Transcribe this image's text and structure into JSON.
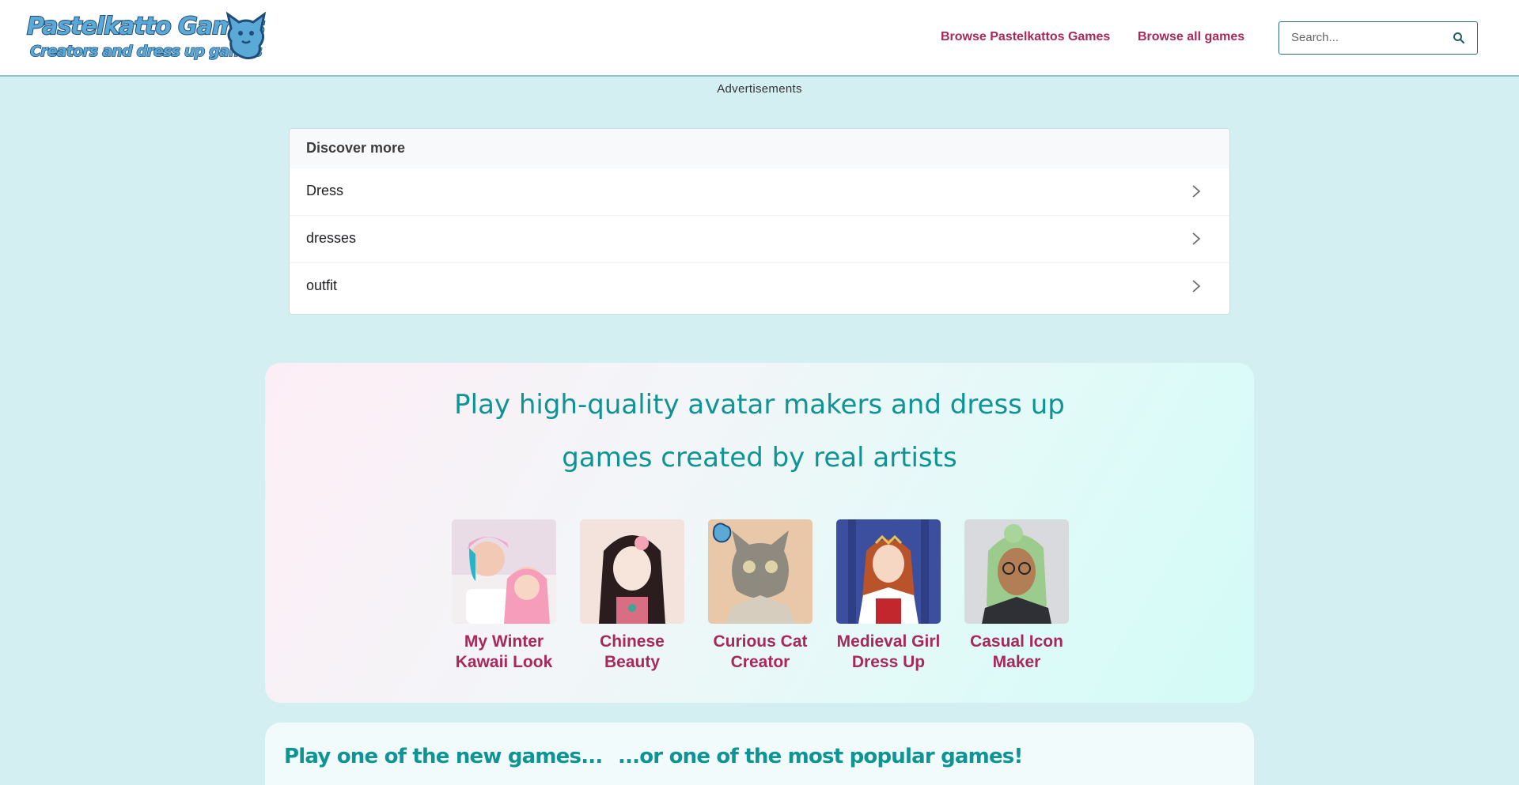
{
  "header": {
    "logo": {
      "line1": "Pastelkatto Games",
      "line2": "Creators and dress up games"
    },
    "nav": [
      {
        "label": "Browse Pastelkattos Games"
      },
      {
        "label": "Browse all games"
      }
    ],
    "search": {
      "placeholder": "Search..."
    }
  },
  "ads_label": "Advertisements",
  "discover": {
    "title": "Discover more",
    "items": [
      {
        "label": "Dress"
      },
      {
        "label": "dresses"
      },
      {
        "label": "outfit"
      }
    ]
  },
  "hero": {
    "title_line1": "Play high-quality avatar makers and dress up",
    "title_line2": "games created by real artists",
    "games": [
      {
        "title": "My Winter Kawaii Look"
      },
      {
        "title": "Chinese Beauty"
      },
      {
        "title": "Curious Cat Creator"
      },
      {
        "title": "Medieval Girl Dress Up"
      },
      {
        "title": "Casual Icon Maker"
      }
    ]
  },
  "bottom": {
    "heading_new": "Play one of the new games...",
    "heading_popular": "...or one of the most popular games!"
  },
  "colors": {
    "page_bg": "#d3eff1",
    "link": "#a8285a",
    "accent_teal": "#0e9494",
    "search_border": "#2a6f74"
  },
  "icons": [
    "search-icon",
    "chevron-right-icon",
    "cat-logo-icon"
  ]
}
